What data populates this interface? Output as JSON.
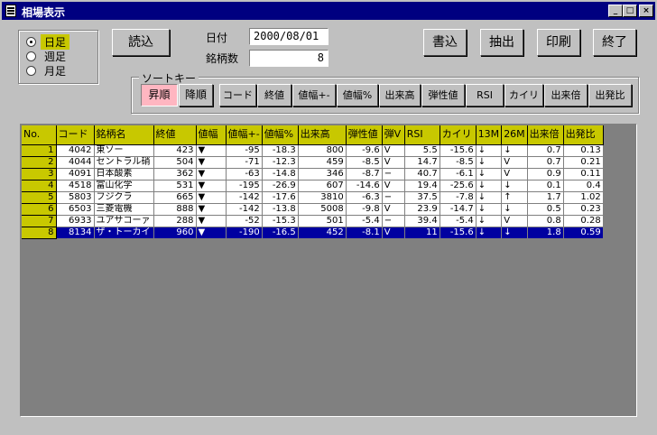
{
  "window": {
    "title": "相場表示",
    "min": "_",
    "max": "□",
    "close": "×"
  },
  "period": {
    "options": [
      {
        "label": "日足",
        "checked": true
      },
      {
        "label": "週足",
        "checked": false
      },
      {
        "label": "月足",
        "checked": false
      }
    ]
  },
  "buttons": {
    "load": "読込",
    "write": "書込",
    "extract": "抽出",
    "print": "印刷",
    "exit": "終了"
  },
  "date": {
    "label": "日付",
    "value": "2000/08/01"
  },
  "count": {
    "label": "銘柄数",
    "value": "8"
  },
  "sortkey": {
    "legend": "ソートキー",
    "order_buttons": [
      {
        "label": "昇順",
        "active": true
      },
      {
        "label": "降順",
        "active": false
      }
    ],
    "keys": [
      "コード",
      "終値",
      "値幅+-",
      "値幅%",
      "出来高",
      "弾性値",
      "RSI",
      "カイリ",
      "出来倍",
      "出発比"
    ]
  },
  "table": {
    "columns": [
      "No.",
      "コード",
      "銘柄名",
      "終値",
      "値幅",
      "値幅+-",
      "値幅%",
      "出来高",
      "弾性値",
      "弾V",
      "RSI",
      "カイリ",
      "13M",
      "26M",
      "出来倍",
      "出発比"
    ],
    "rows": [
      [
        "1",
        "4042",
        "東ソー",
        "423",
        "▼",
        "-95",
        "-18.3",
        "800",
        "-9.6",
        "V",
        "5.5",
        "-15.6",
        "↓",
        "↓",
        "0.7",
        "0.13"
      ],
      [
        "2",
        "4044",
        "セントラル硝",
        "504",
        "▼",
        "-71",
        "-12.3",
        "459",
        "-8.5",
        "V",
        "14.7",
        "-8.5",
        "↓",
        "V",
        "0.7",
        "0.21"
      ],
      [
        "3",
        "4091",
        "日本酸素",
        "362",
        "▼",
        "-63",
        "-14.8",
        "346",
        "-8.7",
        "−",
        "40.7",
        "-6.1",
        "↓",
        "V",
        "0.9",
        "0.11"
      ],
      [
        "4",
        "4518",
        "富山化学",
        "531",
        "▼",
        "-195",
        "-26.9",
        "607",
        "-14.6",
        "V",
        "19.4",
        "-25.6",
        "↓",
        "↓",
        "0.1",
        "0.4"
      ],
      [
        "5",
        "5803",
        "フジクラ",
        "665",
        "▼",
        "-142",
        "-17.6",
        "3810",
        "-6.3",
        "−",
        "37.5",
        "-7.8",
        "↓",
        "↑",
        "1.7",
        "1.02"
      ],
      [
        "6",
        "6503",
        "三菱電機",
        "888",
        "▼",
        "-142",
        "-13.8",
        "5008",
        "-9.8",
        "V",
        "23.9",
        "-14.7",
        "↓",
        "↓",
        "0.5",
        "0.23"
      ],
      [
        "7",
        "6933",
        "ユアサコーァ",
        "288",
        "▼",
        "-52",
        "-15.3",
        "501",
        "-5.4",
        "−",
        "39.4",
        "-5.4",
        "↓",
        "V",
        "0.8",
        "0.28"
      ],
      [
        "8",
        "8134",
        "ザ・トーカイ",
        "960",
        "▼",
        "-190",
        "-16.5",
        "452",
        "-8.1",
        "V",
        "11",
        "-15.6",
        "↓",
        "↓",
        "1.8",
        "0.59"
      ]
    ],
    "selected_row": 8
  }
}
